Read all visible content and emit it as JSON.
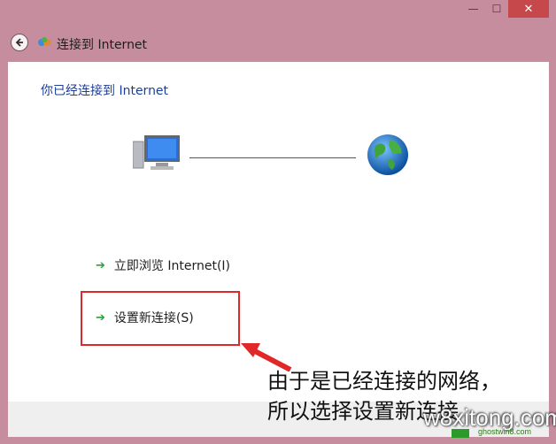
{
  "window": {
    "title": "连接到 Internet",
    "controls": {
      "minimize": "—",
      "maximize": "☐",
      "close": "✕"
    }
  },
  "content": {
    "heading": "你已经连接到 Internet",
    "links": [
      {
        "label": "立即浏览 Internet(I)",
        "icon": "green-arrow-icon"
      },
      {
        "label": "设置新连接(S)",
        "icon": "green-arrow-icon"
      }
    ]
  },
  "annotation": {
    "line1": "由于是已经连接的网络，",
    "line2": "所以选择设置新连接"
  },
  "watermark": {
    "text": "w8xitong.com",
    "sub": "ghostwin8.com"
  },
  "colors": {
    "frame": "#c58d9e",
    "heading": "#1c3f95",
    "highlight": "#e02828",
    "arrow": "#2aa23c",
    "close": "#c7484a"
  }
}
